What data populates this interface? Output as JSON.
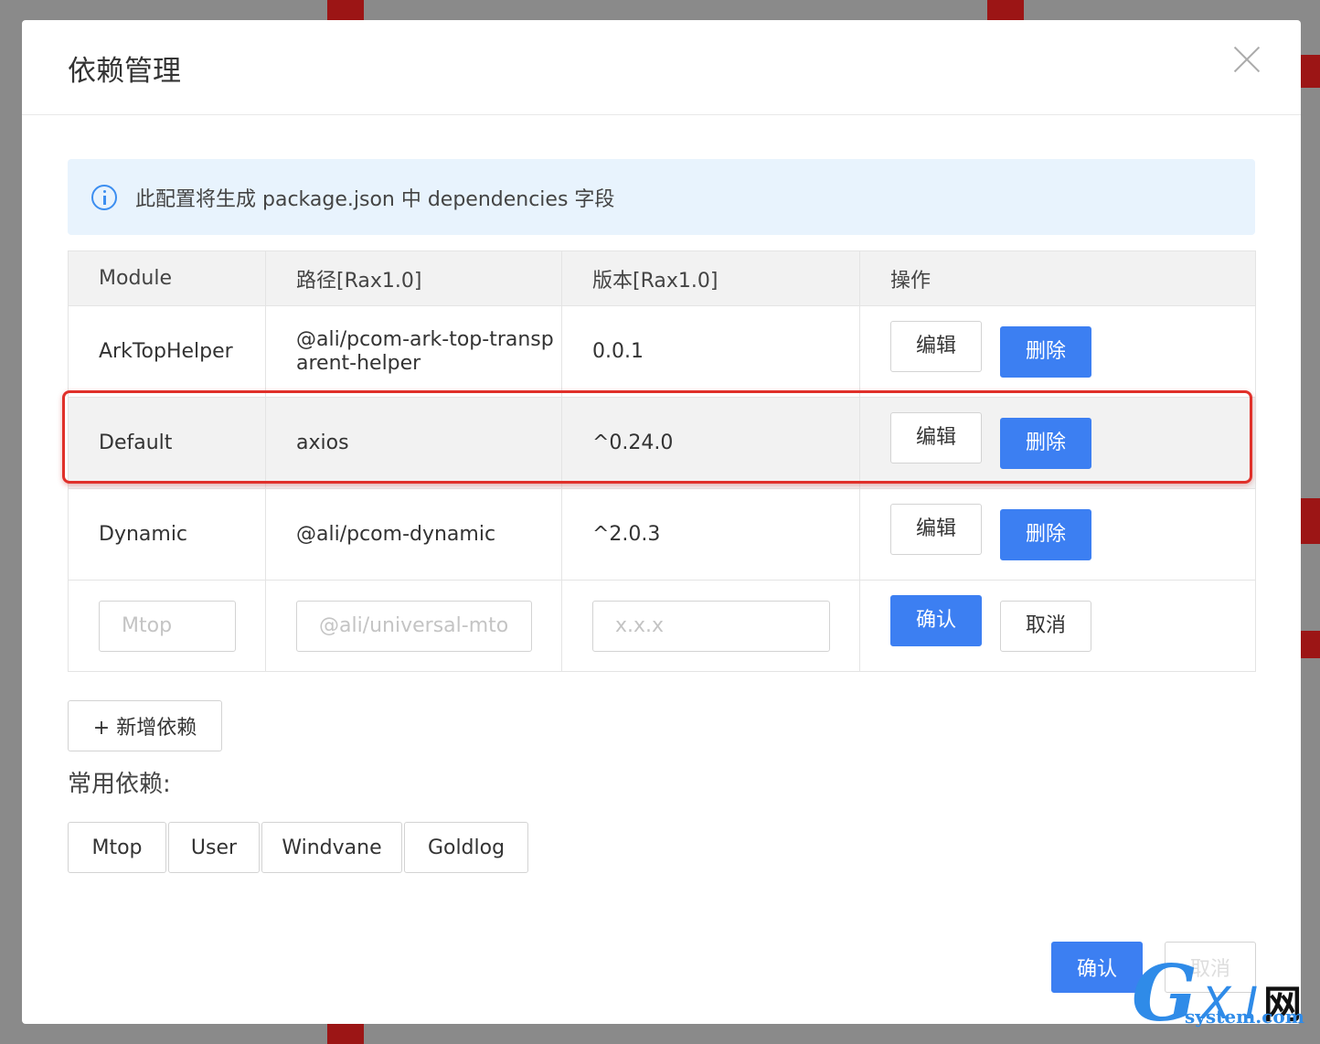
{
  "modal": {
    "title": "依赖管理",
    "info": "此配置将生成 package.json 中 dependencies 字段"
  },
  "table": {
    "headers": [
      "Module",
      "路径[Rax1.0]",
      "版本[Rax1.0]",
      "操作"
    ],
    "rows": [
      {
        "module": "ArkTopHelper",
        "path": "@ali/pcom-ark-top-transparent-helper",
        "version": "0.0.1",
        "edit": "编辑",
        "delete": "删除"
      },
      {
        "module": "Default",
        "path": "axios",
        "version": "^0.24.0",
        "edit": "编辑",
        "delete": "删除"
      },
      {
        "module": "Dynamic",
        "path": "@ali/pcom-dynamic",
        "version": "^2.0.3",
        "edit": "编辑",
        "delete": "删除"
      }
    ],
    "new_row": {
      "module_placeholder": "Mtop",
      "path_placeholder": "@ali/universal-mtop",
      "version_placeholder": "x.x.x",
      "confirm": "确认",
      "cancel": "取消"
    }
  },
  "add_button": "+ 新增依赖",
  "common": {
    "label": "常用依赖:",
    "tags": [
      "Mtop",
      "User",
      "Windvane",
      "Goldlog"
    ]
  },
  "footer": {
    "ok": "确认",
    "cancel": "取消"
  },
  "watermark": {
    "g": "G",
    "xi": "X I",
    "net": "网",
    "site": "system.com"
  },
  "colors": {
    "primary": "#3c7ff2",
    "highlight_border": "#e0302a",
    "info_bg": "#e8f3fd"
  }
}
